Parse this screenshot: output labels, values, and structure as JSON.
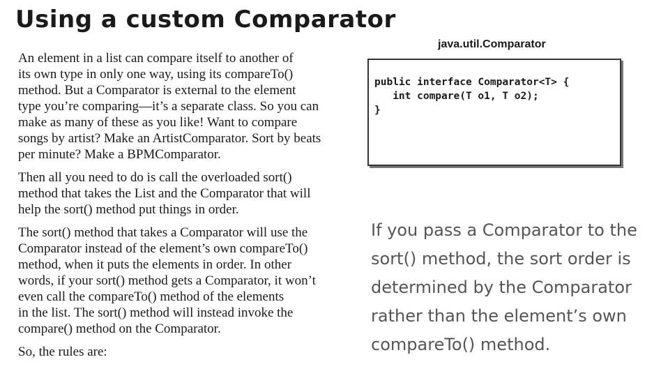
{
  "title": "Using a custom Comparator",
  "paragraphs": {
    "p1": [
      "An element in a list can compare itself to another of",
      "its own type in only one way, using its compareTo()",
      "method. But a Comparator is external to the element",
      "type you’re comparing—it’s a separate class. So you can",
      "make as many of these as you like! Want to compare",
      "songs by artist? Make an ArtistComparator. Sort by beats",
      "per minute? Make a BPMComparator."
    ],
    "p2": [
      "Then all you need to do is call the overloaded sort()",
      "method that takes the List and the Comparator that will",
      "help the sort() method put things in order."
    ],
    "p3": [
      "The sort() method that takes a Comparator will use the",
      "Comparator instead of the element’s own compareTo()",
      "method, when it puts the elements in order. In other",
      "words, if your sort() method gets a Comparator, it won’t",
      "even call the compareTo() method of the elements",
      "in the list. The sort() method will instead invoke the",
      "compare() method on the Comparator."
    ],
    "p4": "So, the rules are:"
  },
  "code_box": {
    "label": "java.util.Comparator",
    "lines": [
      "public interface Comparator<T> {",
      "   int compare(T o1, T o2);",
      "}"
    ]
  },
  "callout": {
    "lines": [
      "If you pass a Comparator to the",
      "sort() method, the sort order is",
      "determined by the Comparator",
      "rather than the element’s own",
      "compareTo() method."
    ]
  }
}
